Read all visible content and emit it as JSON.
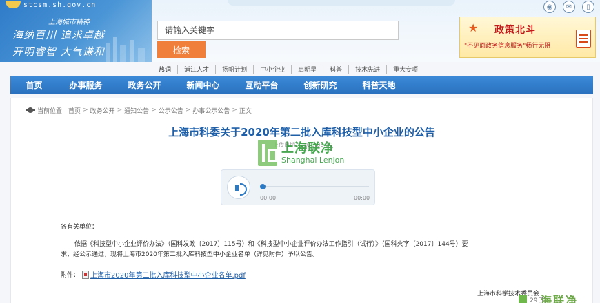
{
  "header": {
    "site_url": "stcsm.sh.gov.cn",
    "spirit_label": "上海城市精神",
    "slogan_line1": "海纳百川  追求卓越",
    "slogan_line2": "开明睿智  大气谦和",
    "search": {
      "placeholder": "请输入关键字",
      "button_label": "检索"
    },
    "hot": {
      "label": "热词:",
      "links": [
        "浦江人才",
        "扬帆计划",
        "中小企业",
        "启明星",
        "科普",
        "技术先进",
        "重大专项"
      ]
    },
    "policy_ad": {
      "title": "政策北斗",
      "subtitle": "\"不见面政务信息服务\"畅行无阻"
    },
    "social_icons": [
      "weibo-icon",
      "wechat-icon",
      "mobile-icon"
    ]
  },
  "nav": {
    "items": [
      "首页",
      "办事服务",
      "政务公开",
      "新闻中心",
      "互动平台",
      "创新研究",
      "科普天地"
    ]
  },
  "breadcrumb": {
    "label": "当前位置:",
    "items": [
      "首页",
      "政务公开",
      "通知公告",
      "公示公告",
      "办事公示公告"
    ],
    "current": "正文"
  },
  "article": {
    "title": "上海市科委关于2020年第二批入库科技型中小企业的公告",
    "date_line": "上传日期：2020-06-30",
    "salutation": "各有关单位：",
    "paragraph_line1": "依据《科技型中小企业评价办法》（国科发政〔2017〕115号）和《科技型中小企业评价办法工作指引（试行）》（国科火字〔2017〕144号）要",
    "paragraph_line2": "求，经公示通过，现将上海市2020年第二批入库科技型中小企业名单（详见附件）予以公告。",
    "attachment_label": "附件：",
    "attachment_link": "上海市2020年第二批入库科技型中小企业名单.pdf",
    "signer": "上海市科学技术委员会"
  },
  "audio": {
    "time_start": "00:00",
    "time_end": "00:00",
    "progress": 0
  },
  "watermark": {
    "cn": "上海联净",
    "en": "Shanghai Lenjon",
    "corner_text": "海联净",
    "corner_day": "29日"
  }
}
